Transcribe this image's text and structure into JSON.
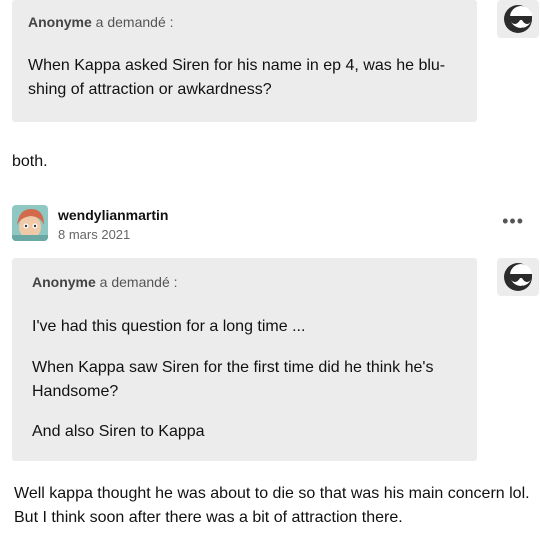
{
  "ask1": {
    "asker": "Anonyme",
    "asked_suffix": " a demandé :",
    "question": "When Kappa asked Siren for his name in ep 4, was he blu-shing of attraction or awkardness?"
  },
  "answer1": "both.",
  "post2": {
    "username": "wendylianmartin",
    "date": "8 mars 2021",
    "more_icon": "•••",
    "ask": {
      "asker": "Anonyme",
      "asked_suffix": " a demandé :",
      "paragraphs": [
        "I've had this question for a long time ...",
        "When Kappa saw Siren for the first time did he think he's Handsome?",
        "And also Siren to Kappa"
      ]
    },
    "answer": "Well kappa thought he was about to die so that was his main concern lol. But I think soon after there was a bit of attraction there."
  },
  "icons": {
    "anon_avatar": "sunglasses-avatar-icon",
    "more": "more-options-icon"
  }
}
